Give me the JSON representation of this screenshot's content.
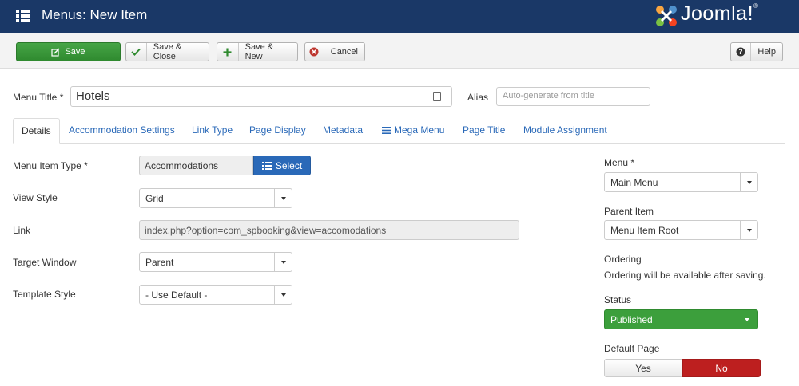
{
  "header": {
    "title": "Menus: New Item",
    "logo_text": "Joomla!",
    "logo_reg": "®"
  },
  "toolbar": {
    "save_label": "Save",
    "save_close_label": "Save & Close",
    "save_new_label": "Save & New",
    "cancel_label": "Cancel",
    "help_label": "Help"
  },
  "form": {
    "title_label": "Menu Title *",
    "title_value": "Hotels",
    "alias_label": "Alias",
    "alias_placeholder": "Auto-generate from title"
  },
  "tabs": [
    {
      "label": "Details"
    },
    {
      "label": "Accommodation Settings"
    },
    {
      "label": "Link Type"
    },
    {
      "label": "Page Display"
    },
    {
      "label": "Metadata"
    },
    {
      "label": "Mega Menu"
    },
    {
      "label": "Page Title"
    },
    {
      "label": "Module Assignment"
    }
  ],
  "details": {
    "item_type_label": "Menu Item Type *",
    "item_type_value": "Accommodations",
    "select_label": "Select",
    "view_style_label": "View Style",
    "view_style_value": "Grid",
    "link_label": "Link",
    "link_value": "index.php?option=com_spbooking&view=accomodations",
    "target_label": "Target Window",
    "target_value": "Parent",
    "template_label": "Template Style",
    "template_value": "- Use Default -"
  },
  "sidebar": {
    "menu_label": "Menu *",
    "menu_value": "Main Menu",
    "parent_label": "Parent Item",
    "parent_value": "Menu Item Root",
    "ordering_label": "Ordering",
    "ordering_note": "Ordering will be available after saving.",
    "status_label": "Status",
    "status_value": "Published",
    "default_label": "Default Page",
    "default_yes": "Yes",
    "default_no": "No"
  },
  "colors": {
    "header_bg": "#1a3867",
    "save_green": "#46a546",
    "select_blue": "#2a69b8",
    "no_red": "#bd1f1f",
    "published_green": "#3c9f3c"
  }
}
